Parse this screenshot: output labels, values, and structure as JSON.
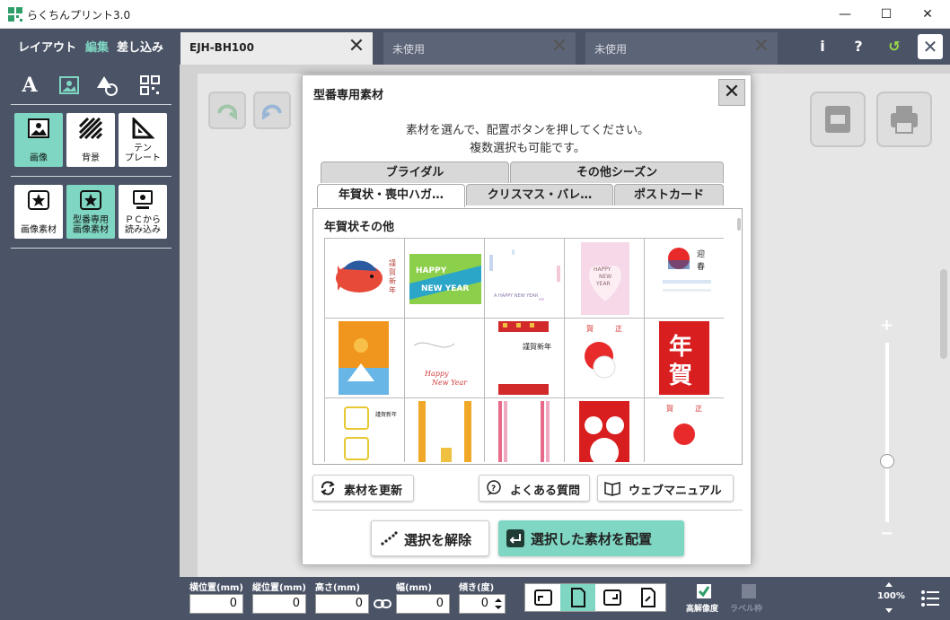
{
  "window": {
    "title": "らくちんプリント3.0",
    "minimize": "—",
    "maximize": "☐",
    "close": "✕"
  },
  "mode_tabs": [
    "レイアウト",
    "編集",
    "差し込み"
  ],
  "doc_tabs": [
    {
      "label": "EJH-BH100",
      "active": true
    },
    {
      "label": "未使用",
      "active": false
    },
    {
      "label": "未使用",
      "active": false
    }
  ],
  "top_tools": {
    "info": "i",
    "help": "?",
    "undo": "↺",
    "close": "✕"
  },
  "sidebar": {
    "text_icon": "A",
    "tiles_row1": [
      {
        "label": "画像",
        "active": true
      },
      {
        "label": "背景",
        "active": false
      },
      {
        "label": "テン\nプレート",
        "active": false
      }
    ],
    "tiles_row2": [
      {
        "label": "画像素材",
        "active": false
      },
      {
        "label": "型番専用\n画像素材",
        "active": true
      },
      {
        "label": "ＰＣから\n読み込み",
        "active": false
      }
    ]
  },
  "modal": {
    "title": "型番専用素材",
    "close": "✕",
    "instruction_line1": "素材を選んで、配置ボタンを押してください。",
    "instruction_line2": "複数選択も可能です。",
    "tabs_back": [
      "ブライダル",
      "その他シーズン"
    ],
    "tabs_front": [
      "年賀状・喪中ハガ…",
      "クリスマス・バレ…",
      "ポストカード"
    ],
    "panel_title": "年賀状その他",
    "thumbnails": [
      {
        "texts": [
          "謹",
          "賀",
          "新",
          "年"
        ]
      },
      {
        "texts": [
          "HAPPY",
          "NEW YEAR"
        ]
      },
      {
        "texts": [
          "A HAPPY NEW YEAR"
        ]
      },
      {
        "texts": [
          "HAPPY",
          "NEW",
          "YEAR"
        ]
      },
      {
        "texts": [
          "迎",
          "春"
        ]
      },
      {
        "texts": []
      },
      {
        "texts": [
          "Happy",
          "New Year"
        ]
      },
      {
        "texts": [
          "謹賀新年"
        ]
      },
      {
        "texts": [
          "賀",
          "正"
        ]
      },
      {
        "texts": [
          "年",
          "賀"
        ]
      },
      {
        "texts": [
          "謹賀新年"
        ]
      },
      {
        "texts": []
      },
      {
        "texts": []
      },
      {
        "texts": []
      },
      {
        "texts": [
          "賀",
          "正"
        ]
      }
    ],
    "refresh_button": "素材を更新",
    "faq_button": "よくある質問",
    "manual_button": "ウェブマニュアル",
    "deselect_button": "選択を解除",
    "place_button": "選択した素材を配置"
  },
  "bottom": {
    "labels": {
      "x": "横位置(mm)",
      "y": "縦位置(mm)",
      "h": "高さ(mm)",
      "w": "幅(mm)",
      "angle": "傾き(度)"
    },
    "values": {
      "x": "0",
      "y": "0",
      "h": "0",
      "w": "0",
      "angle": "0"
    },
    "high_res": "高解像度",
    "label_frame": "ラベル枠",
    "zoom": "100%"
  },
  "zoom_slider": {
    "plus": "+",
    "minus": "−",
    "level": 0.34
  },
  "colors": {
    "dark": "#4b5467",
    "accent": "#7fd6c2"
  }
}
